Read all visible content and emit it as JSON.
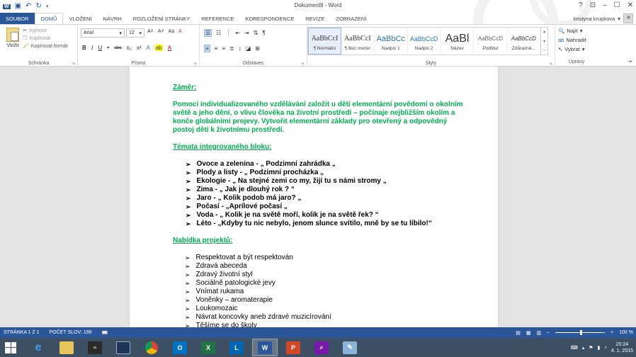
{
  "window": {
    "title": "Dokument8 - Word",
    "controls": [
      "?",
      "⊡",
      "–",
      "☐",
      "✕"
    ]
  },
  "qat": {
    "save_icon": "save-icon",
    "undo_icon": "undo-icon",
    "redo_icon": "redo-icon"
  },
  "tabs": [
    {
      "label": "SOUBOR"
    },
    {
      "label": "DOMŮ"
    },
    {
      "label": "VLOŽENÍ"
    },
    {
      "label": "NÁVRH"
    },
    {
      "label": "ROZLOŽENÍ STRÁNKY"
    },
    {
      "label": "REFERENCE"
    },
    {
      "label": "KORESPONDENCE"
    },
    {
      "label": "REVIZE"
    },
    {
      "label": "ZOBRAZENÍ"
    }
  ],
  "user": {
    "name": "kristyna krupkova"
  },
  "ribbon": {
    "clipboard": {
      "paste": "Vložit",
      "cut": "Vyjmout",
      "copy": "Kopírovat",
      "format_painter": "Kopírovat formát",
      "group": "Schránka"
    },
    "font": {
      "family": "Arial",
      "size": "12",
      "group": "Písmo",
      "bold": "B",
      "italic": "I",
      "underline": "U",
      "strike": "abc",
      "sub": "x₂",
      "sup": "x²",
      "grow": "A˄",
      "shrink": "A˅",
      "case": "Aa",
      "clear": "A",
      "effects": "A",
      "highlight": "ab",
      "color": "A"
    },
    "paragraph": {
      "group": "Odstavec"
    },
    "styles": {
      "group": "Styly",
      "items": [
        {
          "sample": "AaBbCcI",
          "name": "¶ Normální"
        },
        {
          "sample": "AaBbCcI",
          "name": "¶ Bez mezer"
        },
        {
          "sample": "AaBbCc",
          "name": "Nadpis 1"
        },
        {
          "sample": "AaBbCcD",
          "name": "Nadpis 2"
        },
        {
          "sample": "AaBl",
          "name": "Název"
        },
        {
          "sample": "AaBbCcD",
          "name": "Podtitul"
        },
        {
          "sample": "AaBbCcD",
          "name": "Zdůrazně..."
        }
      ]
    },
    "editing": {
      "group": "Úpravy",
      "find": "Najít",
      "replace": "Nahradit",
      "select": "Vybrat"
    }
  },
  "document": {
    "heading1": "Záměr:",
    "paragraph1": "Pomocí individualizovaného vzdělávání založit u dětí elementární povědomí o okolním světě a jeho dění, o vlivu člověka na životní prostředí – počínaje nejbližším okolím a konče globálními projevy. Vytvořit elementární základy pro otevřený a odpovědný postoj dětí k životnímu prostředí.",
    "heading2": "Témata integrovaného bloku:",
    "topics": [
      "Ovoce a zelenina - „ Podzimní  zahrádka „",
      "Plody a listy - „ Podzimní  procházka „",
      "Ekologie - „ Na stejné zemi co my, žijí tu s námi stromy „",
      "Zima - „ Jak je dlouhý rok ? “",
      "Jaro - „ Kolik podob má jaro? „",
      "Počasí - „Aprílové počasí „",
      "Voda - „ Kolik je na světě moří, kolik je na světě řek? “",
      "Léto - „Kdyby tu nic nebylo, jenom slunce svítilo, mně by se tu líbilo!“"
    ],
    "heading3": "Nabídka projektů:",
    "projects": [
      "Respektovat a být respektován",
      "Zdravá abeceda",
      "Zdravý životní styl",
      "Sociálně patologické jevy",
      "Vnímat rukama",
      "Voněnky – aromaterapie",
      "Loukomozaic",
      "Návrat koncovky aneb zdravé muzicírování",
      "Těšíme se do školy"
    ]
  },
  "statusbar": {
    "page": "STRÁNKA 1 Z 1",
    "words": "POČET SLOV: 196",
    "zoom": "100 %"
  },
  "taskbar": {
    "clock_time": "20:24",
    "clock_date": "4. 1. 2015"
  },
  "colors": {
    "word_blue": "#2b579a",
    "heading_green": "#00b050",
    "taskbar": "#3d4f63"
  }
}
